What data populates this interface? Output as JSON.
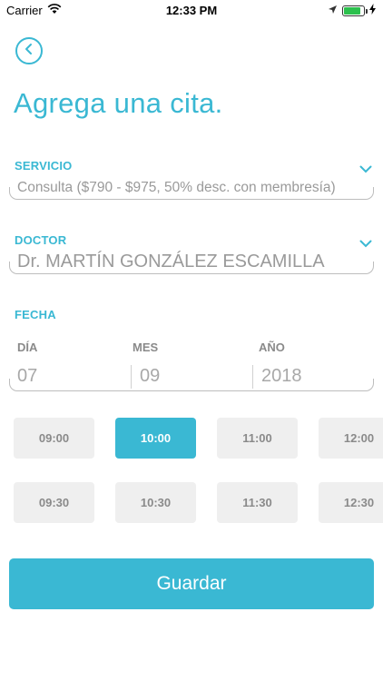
{
  "status_bar": {
    "carrier": "Carrier",
    "time": "12:33 PM",
    "battery_level": 0.85,
    "battery_color": "#2cc04d"
  },
  "accent_color": "#3ab8d3",
  "page": {
    "title": "Agrega una cita."
  },
  "servicio": {
    "label": "SERVICIO",
    "value": "Consulta ($790 - $975, 50% desc. con membresía)"
  },
  "doctor": {
    "label": "DOCTOR",
    "value": "Dr. MARTÍN GONZÁLEZ ESCAMILLA"
  },
  "fecha": {
    "label": "FECHA",
    "day_label": "DÍA",
    "month_label": "MES",
    "year_label": "AÑO",
    "day": "07",
    "month": "09",
    "year": "2018"
  },
  "times": {
    "row1": [
      "09:00",
      "10:00",
      "11:00",
      "12:00"
    ],
    "row2": [
      "09:30",
      "10:30",
      "11:30",
      "12:30"
    ],
    "selected": "10:00"
  },
  "save_label": "Guardar"
}
